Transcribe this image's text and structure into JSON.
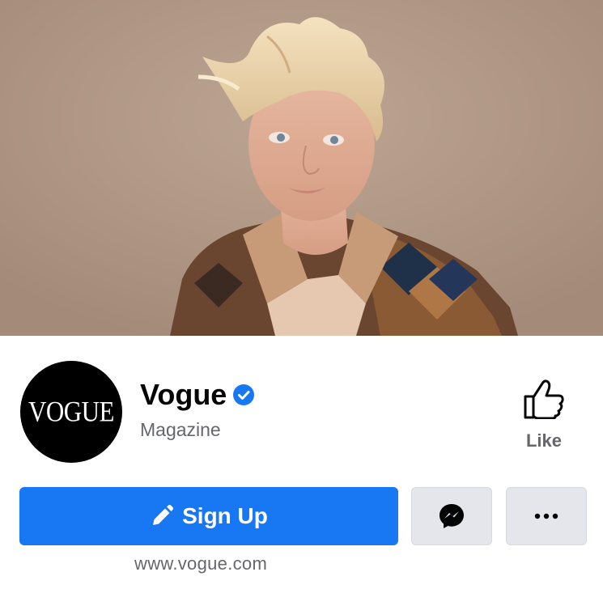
{
  "cover": {
    "description_icon": "cover-photo"
  },
  "profile": {
    "avatar_text": "VOGUE",
    "name": "Vogue",
    "verified": true,
    "category": "Magazine"
  },
  "like": {
    "label": "Like",
    "icon": "thumbs-up-icon"
  },
  "actions": {
    "signup_label": "Sign Up",
    "signup_icon": "pencil-icon",
    "message_icon": "messenger-icon",
    "more_icon": "more-dots-icon"
  },
  "website": "www.vogue.com",
  "colors": {
    "primary_blue": "#1877f2",
    "secondary_text": "#65676b",
    "button_gray": "#e4e6eb",
    "verified_blue": "#1877f2"
  }
}
